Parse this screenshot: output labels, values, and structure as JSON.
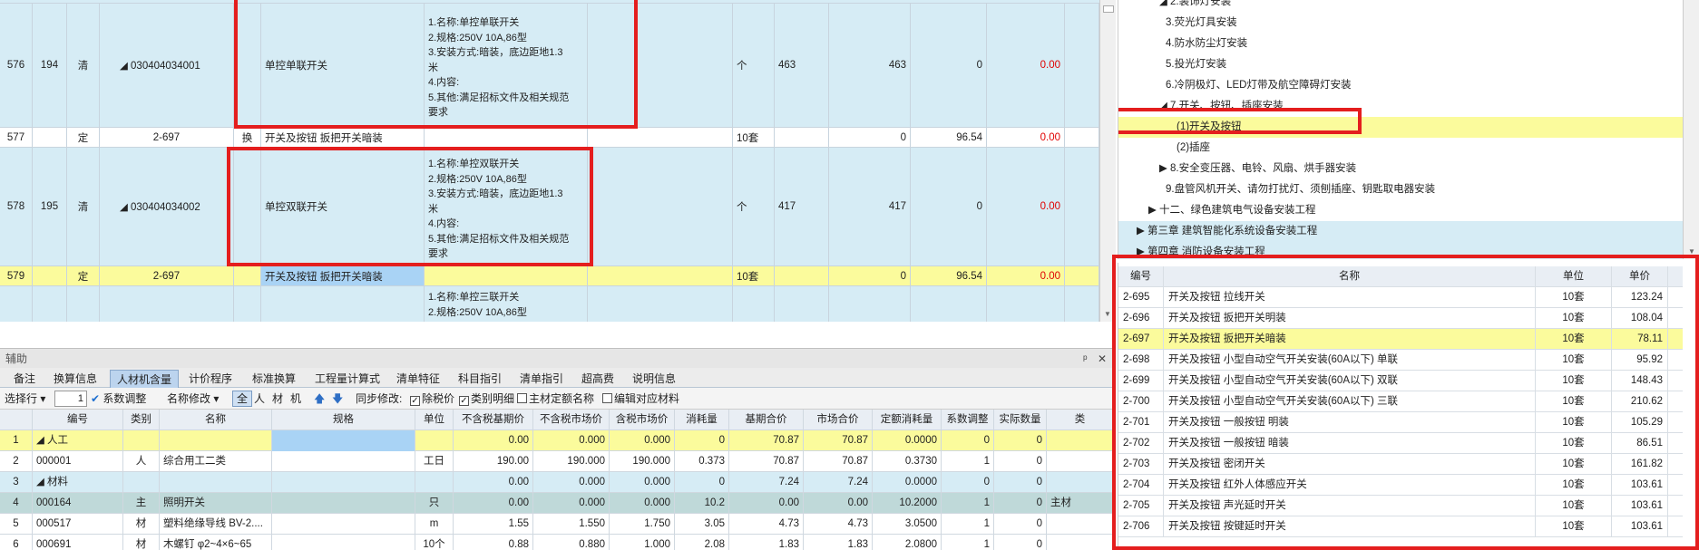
{
  "bill_rows": [
    {
      "seq": "576",
      "no": "194",
      "kind": "清",
      "code": "◢ 030404034001",
      "conv": "",
      "name": "单控单联开关",
      "features": [
        "1.名称:单控单联开关",
        "2.规格:250V 10A,86型",
        "3.安装方式:暗装，底边距地1.3",
        "米",
        "4.内容:",
        "5.其他:满足招标文件及相关规范",
        "要求"
      ],
      "unit": "个",
      "qty": "463",
      "qty2": "463",
      "price": "0",
      "total": "0.00"
    },
    {
      "seq": "577",
      "no": "",
      "kind": "定",
      "code": "2-697",
      "conv": "换",
      "name": "开关及按钮 扳把开关暗装",
      "features": [],
      "unit": "10套",
      "qty": "",
      "qty2": "0",
      "price": "96.54",
      "total": "0.00"
    },
    {
      "seq": "578",
      "no": "195",
      "kind": "清",
      "code": "◢ 030404034002",
      "conv": "",
      "name": "单控双联开关",
      "features": [
        "1.名称:单控双联开关",
        "2.规格:250V 10A,86型",
        "3.安装方式:暗装，底边距地1.3",
        "米",
        "4.内容:",
        "5.其他:满足招标文件及相关规范",
        "要求"
      ],
      "unit": "个",
      "qty": "417",
      "qty2": "417",
      "price": "0",
      "total": "0.00"
    },
    {
      "seq": "579",
      "no": "",
      "kind": "定",
      "code": "2-697",
      "conv": "",
      "name": "开关及按钮 扳把开关暗装",
      "features": [],
      "unit": "10套",
      "qty": "",
      "qty2": "0",
      "price": "96.54",
      "total": "0.00"
    },
    {
      "seq": "",
      "no": "",
      "kind": "",
      "code": "",
      "conv": "",
      "name": "",
      "features": [
        "1.名称:单控三联开关",
        "2.规格:250V 10A,86型"
      ],
      "unit": "",
      "qty": "",
      "qty2": "",
      "price": "",
      "total": ""
    }
  ],
  "aux": {
    "title": "辅助",
    "pin": "ᵖ",
    "close": "✕",
    "tabs": [
      "备注",
      "换算信息",
      "人材机含量",
      "计价程序",
      "标准换算",
      "工程量计算式",
      "清单特征",
      "科目指引",
      "清单指引",
      "超高费",
      "说明信息"
    ],
    "toolbar": {
      "select_row": "选择行",
      "count_value": "1",
      "coef_adjust": "系数调整",
      "name_modify": "名称修改",
      "filter_all": "全",
      "filter_ren": "人",
      "filter_cai": "材",
      "filter_ji": "机",
      "sync_modify": "同步修改:",
      "tax_price": "除税价",
      "category_detail": "类别明细",
      "main_quota_name": "主材定额名称",
      "edit_material": "编辑对应材料"
    },
    "columns": [
      "编号",
      "类别",
      "名称",
      "规格",
      "单位",
      "不含税基期价",
      "不含税市场价",
      "含税市场价",
      "消耗量",
      "基期合价",
      "市场合价",
      "定额消耗量",
      "系数调整",
      "实际数量",
      "类"
    ],
    "rows": [
      {
        "idx": "1",
        "code": "◢ 人工",
        "cat": "",
        "name": "",
        "spec": "",
        "unit": "",
        "base": "0.00",
        "mkt": "0.000",
        "mkt_tax": "0.000",
        "cons": "0",
        "base_sum": "70.87",
        "mkt_sum": "70.87",
        "quota_cons": "0.0000",
        "coef": "0",
        "actual": "0",
        "extra": "",
        "style": "yel"
      },
      {
        "idx": "2",
        "code": "000001",
        "cat": "人",
        "name": "综合用工二类",
        "spec": "",
        "unit": "工日",
        "base": "190.00",
        "mkt": "190.000",
        "mkt_tax": "190.000",
        "cons": "0.373",
        "base_sum": "70.87",
        "mkt_sum": "70.87",
        "quota_cons": "0.3730",
        "coef": "1",
        "actual": "0",
        "extra": "",
        "style": "wht"
      },
      {
        "idx": "3",
        "code": "◢ 材料",
        "cat": "",
        "name": "",
        "spec": "",
        "unit": "",
        "base": "0.00",
        "mkt": "0.000",
        "mkt_tax": "0.000",
        "cons": "0",
        "base_sum": "7.24",
        "mkt_sum": "7.24",
        "quota_cons": "0.0000",
        "coef": "0",
        "actual": "0",
        "extra": "",
        "style": "blu"
      },
      {
        "idx": "4",
        "code": "000164",
        "cat": "主",
        "name": "照明开关",
        "spec": "",
        "unit": "只",
        "base": "0.00",
        "mkt": "0.000",
        "mkt_tax": "0.000",
        "cons": "10.2",
        "base_sum": "0.00",
        "mkt_sum": "0.00",
        "quota_cons": "10.2000",
        "coef": "1",
        "actual": "0",
        "extra": "主材",
        "style": "gray"
      },
      {
        "idx": "5",
        "code": "000517",
        "cat": "材",
        "name": "塑料绝缘导线 BV-2....",
        "spec": "",
        "unit": "m",
        "base": "1.55",
        "mkt": "1.550",
        "mkt_tax": "1.750",
        "cons": "3.05",
        "base_sum": "4.73",
        "mkt_sum": "4.73",
        "quota_cons": "3.0500",
        "coef": "1",
        "actual": "0",
        "extra": "",
        "style": "wht"
      },
      {
        "idx": "6",
        "code": "000691",
        "cat": "材",
        "name": "木螺钉 φ2~4×6~65",
        "spec": "",
        "unit": "10个",
        "base": "0.88",
        "mkt": "0.880",
        "mkt_tax": "1.000",
        "cons": "2.08",
        "base_sum": "1.83",
        "mkt_sum": "1.83",
        "quota_cons": "2.0800",
        "coef": "1",
        "actual": "0",
        "extra": "",
        "style": "wht"
      }
    ]
  },
  "tree": {
    "items": [
      {
        "text": "◢ 2.装饰灯安装",
        "indent": 45,
        "style": ""
      },
      {
        "text": "3.荧光灯具安装",
        "indent": 52,
        "style": ""
      },
      {
        "text": "4.防水防尘灯安装",
        "indent": 52,
        "style": ""
      },
      {
        "text": "5.投光灯安装",
        "indent": 52,
        "style": ""
      },
      {
        "text": "6.冷阴极灯、LED灯带及航空障碍灯安装",
        "indent": 52,
        "style": ""
      },
      {
        "text": "◢ 7.开关、按钮、插座安装",
        "indent": 45,
        "style": ""
      },
      {
        "text": "(1)开关及按钮",
        "indent": 64,
        "style": "sel"
      },
      {
        "text": "(2)插座",
        "indent": 64,
        "style": ""
      },
      {
        "text": "▶ 8.安全变压器、电铃、风扇、烘手器安装",
        "indent": 45,
        "style": ""
      },
      {
        "text": "9.盘管风机开关、请勿打扰灯、须刨插座、钥匙取电器安装",
        "indent": 52,
        "style": ""
      },
      {
        "text": "▶ 十二、绿色建筑电气设备安装工程",
        "indent": 33,
        "style": ""
      },
      {
        "text": "▶ 第三章 建筑智能化系统设备安装工程",
        "indent": 20,
        "style": "blue"
      },
      {
        "text": "▶ 第四章 消防设备安装工程",
        "indent": 20,
        "style": "blue"
      }
    ]
  },
  "quota": {
    "columns": [
      "编号",
      "名称",
      "单位",
      "单价"
    ],
    "rows": [
      {
        "code": "2-695",
        "name": "开关及按钮 拉线开关",
        "unit": "10套",
        "price": "123.24",
        "sel": false
      },
      {
        "code": "2-696",
        "name": "开关及按钮 扳把开关明装",
        "unit": "10套",
        "price": "108.04",
        "sel": false
      },
      {
        "code": "2-697",
        "name": "开关及按钮 扳把开关暗装",
        "unit": "10套",
        "price": "78.11",
        "sel": true
      },
      {
        "code": "2-698",
        "name": "开关及按钮 小型自动空气开关安装(60A以下) 单联",
        "unit": "10套",
        "price": "95.92",
        "sel": false
      },
      {
        "code": "2-699",
        "name": "开关及按钮 小型自动空气开关安装(60A以下) 双联",
        "unit": "10套",
        "price": "148.43",
        "sel": false
      },
      {
        "code": "2-700",
        "name": "开关及按钮 小型自动空气开关安装(60A以下) 三联",
        "unit": "10套",
        "price": "210.62",
        "sel": false
      },
      {
        "code": "2-701",
        "name": "开关及按钮 一般按钮 明装",
        "unit": "10套",
        "price": "105.29",
        "sel": false
      },
      {
        "code": "2-702",
        "name": "开关及按钮 一般按钮 暗装",
        "unit": "10套",
        "price": "86.51",
        "sel": false
      },
      {
        "code": "2-703",
        "name": "开关及按钮 密闭开关",
        "unit": "10套",
        "price": "161.82",
        "sel": false
      },
      {
        "code": "2-704",
        "name": "开关及按钮 红外人体感应开关",
        "unit": "10套",
        "price": "103.61",
        "sel": false
      },
      {
        "code": "2-705",
        "name": "开关及按钮 声光延时开关",
        "unit": "10套",
        "price": "103.61",
        "sel": false
      },
      {
        "code": "2-706",
        "name": "开关及按钮 按键延时开关",
        "unit": "10套",
        "price": "103.61",
        "sel": false
      }
    ]
  },
  "colors": {
    "highlight_red": "#e41e1e",
    "row_blue": "#d6ecf5",
    "row_yellow": "#fbfb9c",
    "total_red": "#e00000"
  }
}
